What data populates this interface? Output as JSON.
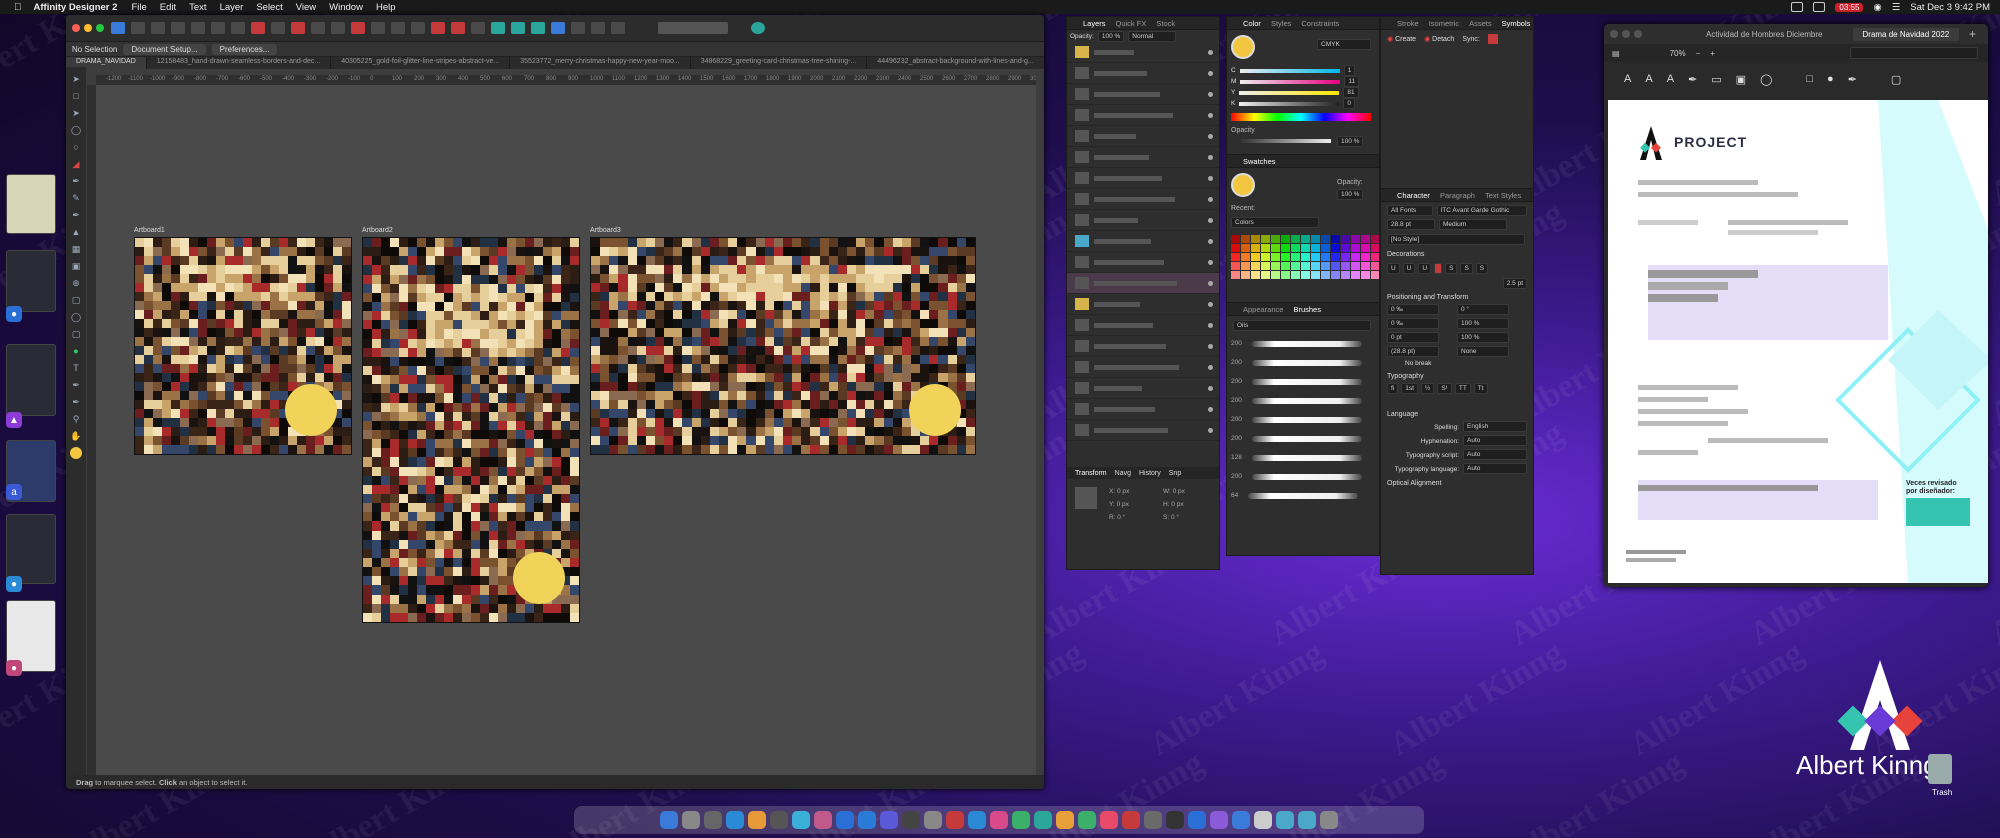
{
  "menubar": {
    "app_name": "Affinity Designer 2",
    "menu_items": [
      "File",
      "Edit",
      "Text",
      "Layer",
      "Select",
      "View",
      "Window",
      "Help"
    ],
    "recording_time": "03:55",
    "clock": "Sat Dec 3  9:42 PM"
  },
  "window": {
    "context": {
      "selection": "No Selection",
      "document_setup": "Document Setup...",
      "preferences": "Preferences..."
    },
    "tabs": [
      "DRAMA_NAVIDAD",
      "12158483_hand-drawn-seamless-borders-and-dec...",
      "40305225_gold-foil-glitter-line-stripes-abstract-ve...",
      "35523772_merry-christmas-happy-new-year-moo...",
      "34868229_greeting-card-christmas-tree-shining-...",
      "44496232_abstract-background-with-lines-and-g..."
    ],
    "ruler_ticks": [
      "-1200",
      "-1100",
      "-1000",
      "-900",
      "-800",
      "-700",
      "-600",
      "-500",
      "-400",
      "-300",
      "-200",
      "-100",
      "0",
      "100",
      "200",
      "300",
      "400",
      "500",
      "600",
      "700",
      "800",
      "900",
      "1000",
      "1100",
      "1200",
      "1300",
      "1400",
      "1500",
      "1600",
      "1700",
      "1800",
      "1900",
      "2000",
      "2100",
      "2200",
      "2300",
      "2400",
      "2500",
      "2600",
      "2700",
      "2800",
      "2900",
      "3000"
    ],
    "artboards": [
      "Artboard1",
      "Artboard2",
      "Artboard3"
    ],
    "status_bold1": "Drag",
    "status_text1": " to marquee select. ",
    "status_bold2": "Click",
    "status_text2": " an object to select it."
  },
  "layers_panel": {
    "tabs": [
      "Layers",
      "Quick FX",
      "Stock"
    ],
    "opacity_label": "Opacity:",
    "opacity_value": "100 %",
    "blend_mode": "Normal"
  },
  "transform_panel": {
    "tabs": [
      "Transform",
      "Navg",
      "History",
      "Snp"
    ],
    "x": "X: 0 px",
    "y": "Y: 0 px",
    "w": "W: 0 px",
    "h": "H: 0 px",
    "r": "R: 0 °",
    "s": "S: 0 °"
  },
  "color_panel": {
    "tabs": [
      "Color",
      "Styles",
      "Constraints"
    ],
    "model": "CMYK",
    "c": "1",
    "m": "11",
    "y": "81",
    "k": "0",
    "opacity_label": "Opacity",
    "opacity_value": "100 %"
  },
  "swatches_panel": {
    "title": "Swatches",
    "opacity_label": "Opacity:",
    "opacity_value": "100 %",
    "recent_label": "Recent:",
    "palette": "Colors"
  },
  "brushes_panel": {
    "tabs": [
      "Appearance",
      "Brushes"
    ],
    "category": "Oils",
    "sizes": [
      "200",
      "200",
      "200",
      "200",
      "200",
      "200",
      "128",
      "200",
      "64"
    ]
  },
  "symbols_panel": {
    "tabs": [
      "Stroke",
      "Isometric",
      "Assets",
      "Symbols"
    ],
    "create": "Create",
    "detach": "Detach",
    "sync": "Sync:"
  },
  "character_panel": {
    "tabs": [
      "Character",
      "Paragraph",
      "Text Styles"
    ],
    "font_collection": "All Fonts",
    "font": "ITC Avant Garde Gothic",
    "size": "28.8 pt",
    "weight": "Medium",
    "style": "[No Style]",
    "decorations": "Decorations",
    "stroke_width": "2.5 pt",
    "positioning": "Positioning and Transform",
    "tracking": "0 ‰",
    "kerning": "0 ‰",
    "baseline": "0 pt",
    "leading": "(28.8 pt)",
    "rotation": "0 °",
    "h_scale": "100 %",
    "v_scale": "100 %",
    "skew": "None",
    "no_break": "No break",
    "typography": "Typography",
    "language": "Language",
    "spelling_label": "Spelling:",
    "spelling": "English",
    "hyphenation_label": "Hyphenation:",
    "hyphenation": "Auto",
    "script_label": "Typography script:",
    "script": "Auto",
    "lang_label": "Typography language:",
    "lang": "Auto",
    "optical": "Optical Alignment"
  },
  "doc_window": {
    "tabs": [
      "Actividad de Hombres Diciembre",
      "Drama de Navidad 2022"
    ],
    "zoom": "70%",
    "project_title": "PROJECT",
    "footer_note_1": "Veces revisado",
    "footer_note_2": "por diseñador:"
  },
  "desktop": {
    "brand": "Albert Kinng",
    "trash_label": "Trash",
    "watermark": "Albert Kinng"
  },
  "colors": {
    "accent_blue": "#3a7ad8",
    "doc_cyan": "#5fe6f0",
    "doc_purple": "#d9d2f7",
    "brand_red": "#e8433a",
    "brand_teal": "#35c4b0"
  }
}
